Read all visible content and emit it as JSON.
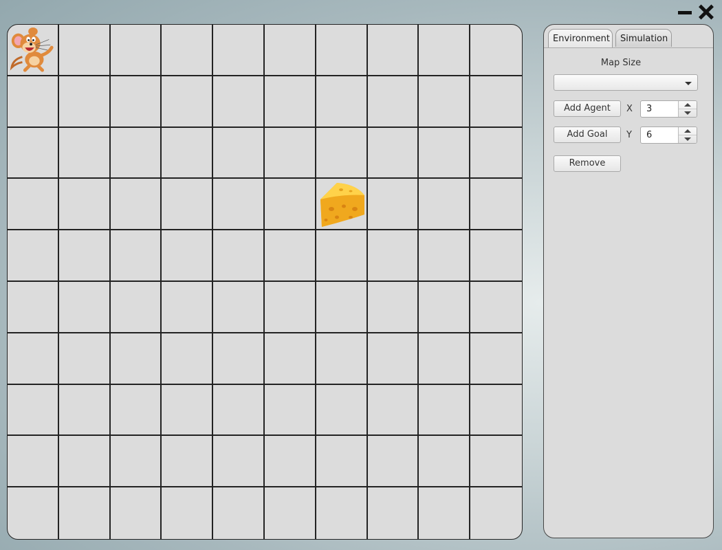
{
  "window": {
    "minimize_icon": "minimize-icon",
    "close_icon": "close-icon"
  },
  "grid": {
    "rows": 10,
    "cols": 10,
    "agent": {
      "row": 0,
      "col": 0,
      "icon": "mouse-character-icon"
    },
    "goal": {
      "row": 3,
      "col": 6,
      "icon": "cheese-icon"
    }
  },
  "panel": {
    "tabs": [
      {
        "label": "Environment",
        "active": true
      },
      {
        "label": "Simulation",
        "active": false
      }
    ],
    "map_size_label": "Map Size",
    "map_size_value": "",
    "add_agent_label": "Add Agent",
    "add_goal_label": "Add Goal",
    "remove_label": "Remove",
    "x_label": "X",
    "x_value": "3",
    "y_label": "Y",
    "y_value": "6"
  },
  "colors": {
    "grid_bg": "#dcdcdc",
    "grid_line": "#222222",
    "panel_bg": "#dcdcdc"
  }
}
